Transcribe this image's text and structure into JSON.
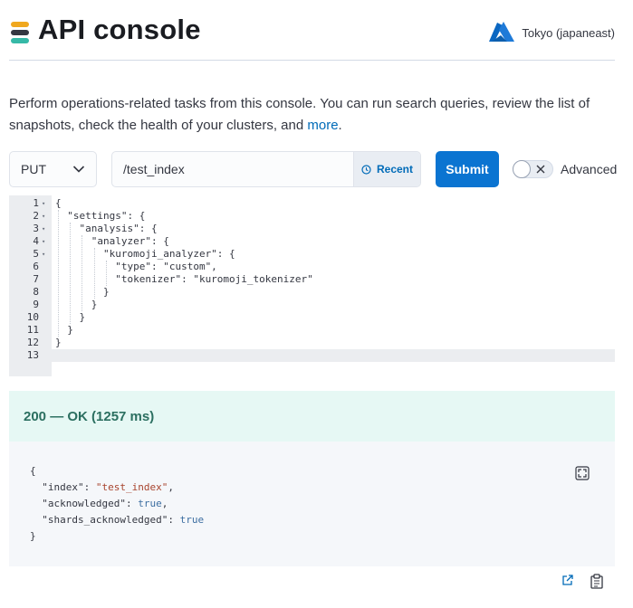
{
  "header": {
    "title": "API console",
    "region": "Tokyo (japaneast)",
    "logo_colors": [
      "#f0a81e",
      "#343741",
      "#36b9a7"
    ]
  },
  "intro": {
    "text": "Perform operations-related tasks from this console. You can run search queries, review the list of snapshots, check the health of your clusters, and ",
    "link": "more",
    "suffix": "."
  },
  "request": {
    "method": "PUT",
    "path": "/test_index",
    "recent_label": "Recent",
    "submit_label": "Submit",
    "advanced_label": "Advanced",
    "advanced_enabled": false
  },
  "editor": {
    "lines": [
      {
        "n": "1",
        "text": "{",
        "fold": true
      },
      {
        "n": "2",
        "text": "  \"settings\": {",
        "fold": true
      },
      {
        "n": "3",
        "text": "    \"analysis\": {",
        "fold": true
      },
      {
        "n": "4",
        "text": "      \"analyzer\": {",
        "fold": true
      },
      {
        "n": "5",
        "text": "        \"kuromoji_analyzer\": {",
        "fold": true
      },
      {
        "n": "6",
        "text": "          \"type\": \"custom\",",
        "fold": false
      },
      {
        "n": "7",
        "text": "          \"tokenizer\": \"kuromoji_tokenizer\"",
        "fold": false
      },
      {
        "n": "8",
        "text": "        }",
        "fold": false
      },
      {
        "n": "9",
        "text": "      }",
        "fold": false
      },
      {
        "n": "10",
        "text": "    }",
        "fold": false
      },
      {
        "n": "11",
        "text": "  }",
        "fold": false
      },
      {
        "n": "12",
        "text": "}",
        "fold": false
      },
      {
        "n": "13",
        "text": "",
        "fold": false
      }
    ],
    "active_line": "13"
  },
  "response": {
    "status": "200 — OK (1257 ms)",
    "lines": [
      [
        {
          "t": "{",
          "c": ""
        }
      ],
      [
        {
          "t": "  \"index\": ",
          "c": ""
        },
        {
          "t": "\"test_index\"",
          "c": "rstr"
        },
        {
          "t": ",",
          "c": ""
        }
      ],
      [
        {
          "t": "  \"acknowledged\": ",
          "c": ""
        },
        {
          "t": "true",
          "c": "rkw"
        },
        {
          "t": ",",
          "c": ""
        }
      ],
      [
        {
          "t": "  \"shards_acknowledged\": ",
          "c": ""
        },
        {
          "t": "true",
          "c": "rkw"
        }
      ],
      [
        {
          "t": "}",
          "c": ""
        }
      ]
    ]
  },
  "icons": {
    "logo": "elastic-logo-icon",
    "region": "azure-icon",
    "method_dropdown": "chevron-down-icon",
    "recent": "clock-icon",
    "toggle": "close-icon",
    "expand": "fullscreen-icon",
    "open_external": "external-link-icon",
    "copy": "clipboard-icon"
  }
}
